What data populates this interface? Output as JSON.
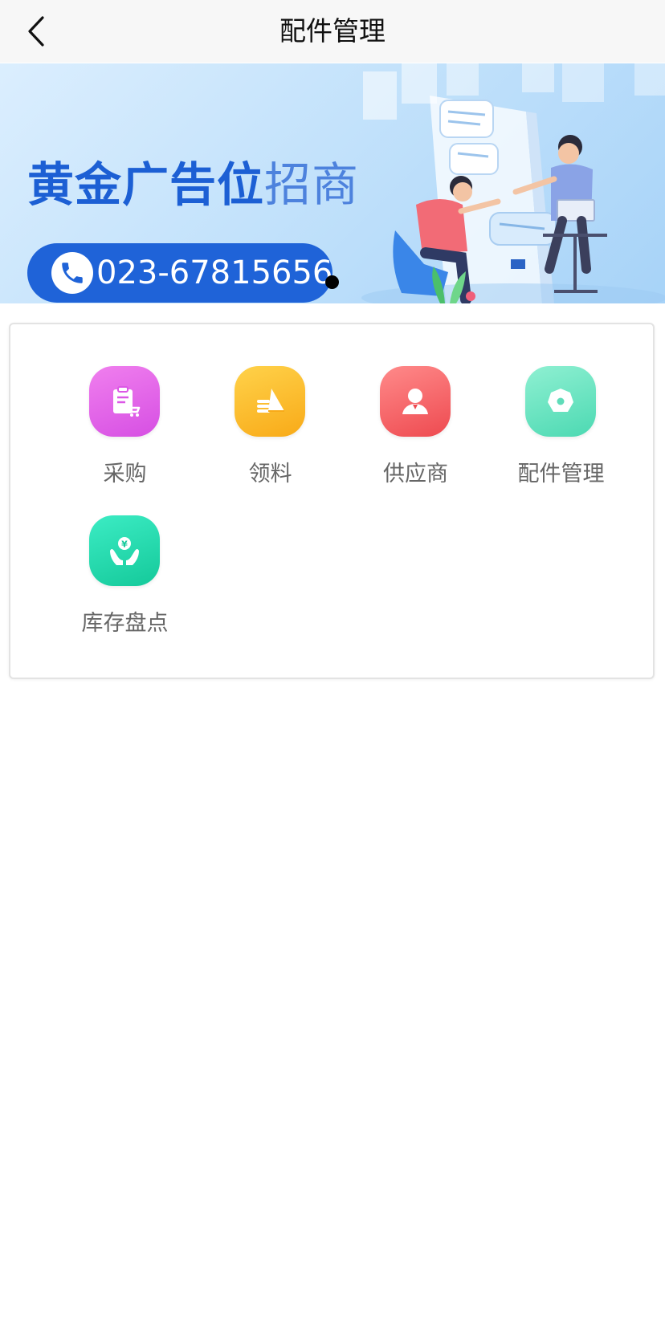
{
  "header": {
    "title": "配件管理",
    "back_icon": "chevron-left-icon"
  },
  "banner": {
    "headline_bold": "黄金广告位",
    "headline_light": "招商",
    "phone_icon": "phone-icon",
    "phone_number": "023-67815656",
    "slide_count": 1,
    "active_slide": 1,
    "colors": {
      "headline": "#1c5fd4",
      "phone_pill": "#1f63d8"
    }
  },
  "menu": {
    "items": [
      {
        "label": "采购",
        "icon": "purchase-clipboard-cart-icon",
        "color": "#e060e8"
      },
      {
        "label": "领料",
        "icon": "requisition-stack-icon",
        "color": "#fbbd2e"
      },
      {
        "label": "供应商",
        "icon": "supplier-person-icon",
        "color": "#f5666a"
      },
      {
        "label": "配件管理",
        "icon": "parts-octagon-icon",
        "color": "#67e3c1"
      },
      {
        "label": "库存盘点",
        "icon": "inventory-hands-yen-icon",
        "color": "#23d8ab"
      }
    ]
  }
}
